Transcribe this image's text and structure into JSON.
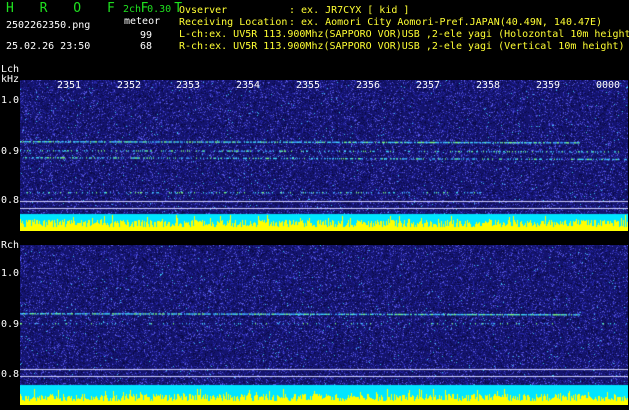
{
  "header": {
    "brand": "H R O F F T",
    "filename": "2502262350.png",
    "datetime": "25.02.26 23:50",
    "mode": "2ch 0.30",
    "meteor_label": "meteor",
    "count_l": "99",
    "count_r": "68"
  },
  "info": {
    "observer_label": "Ovserver",
    "observer_value": ": ex. JR7CYX [ kid ]",
    "location_label": "Receiving Location",
    "location_value": ": ex. Aomori City Aomori-Pref.JAPAN(40.49N, 140.47E)",
    "lch": "L-ch:ex. UV5R 113.900Mhz(SAPPORO VOR)USB ,2-ele yagi (Holozontal 10m height",
    "rch": "R-ch:ex. UV5R 113.900Mhz(SAPPORO VOR)USB ,2-ele yagi (Vertical 10m height)"
  },
  "lpanel": {
    "title": "Lch",
    "unit": "kHz",
    "ticks": [
      "1.0",
      "0.9",
      "0.8"
    ]
  },
  "rpanel": {
    "title": "Rch",
    "ticks": [
      "1.0",
      "0.9",
      "0.8"
    ]
  },
  "time_ticks": [
    "2351",
    "2352",
    "2353",
    "2354",
    "2355",
    "2356",
    "2357",
    "2358",
    "2359",
    "0000"
  ],
  "colors": {
    "text_green": "#1fe11f",
    "background_blue": "#1a1a7a",
    "bar_yellow": "#ffff00",
    "bar_cyan": "#00e5ff"
  }
}
